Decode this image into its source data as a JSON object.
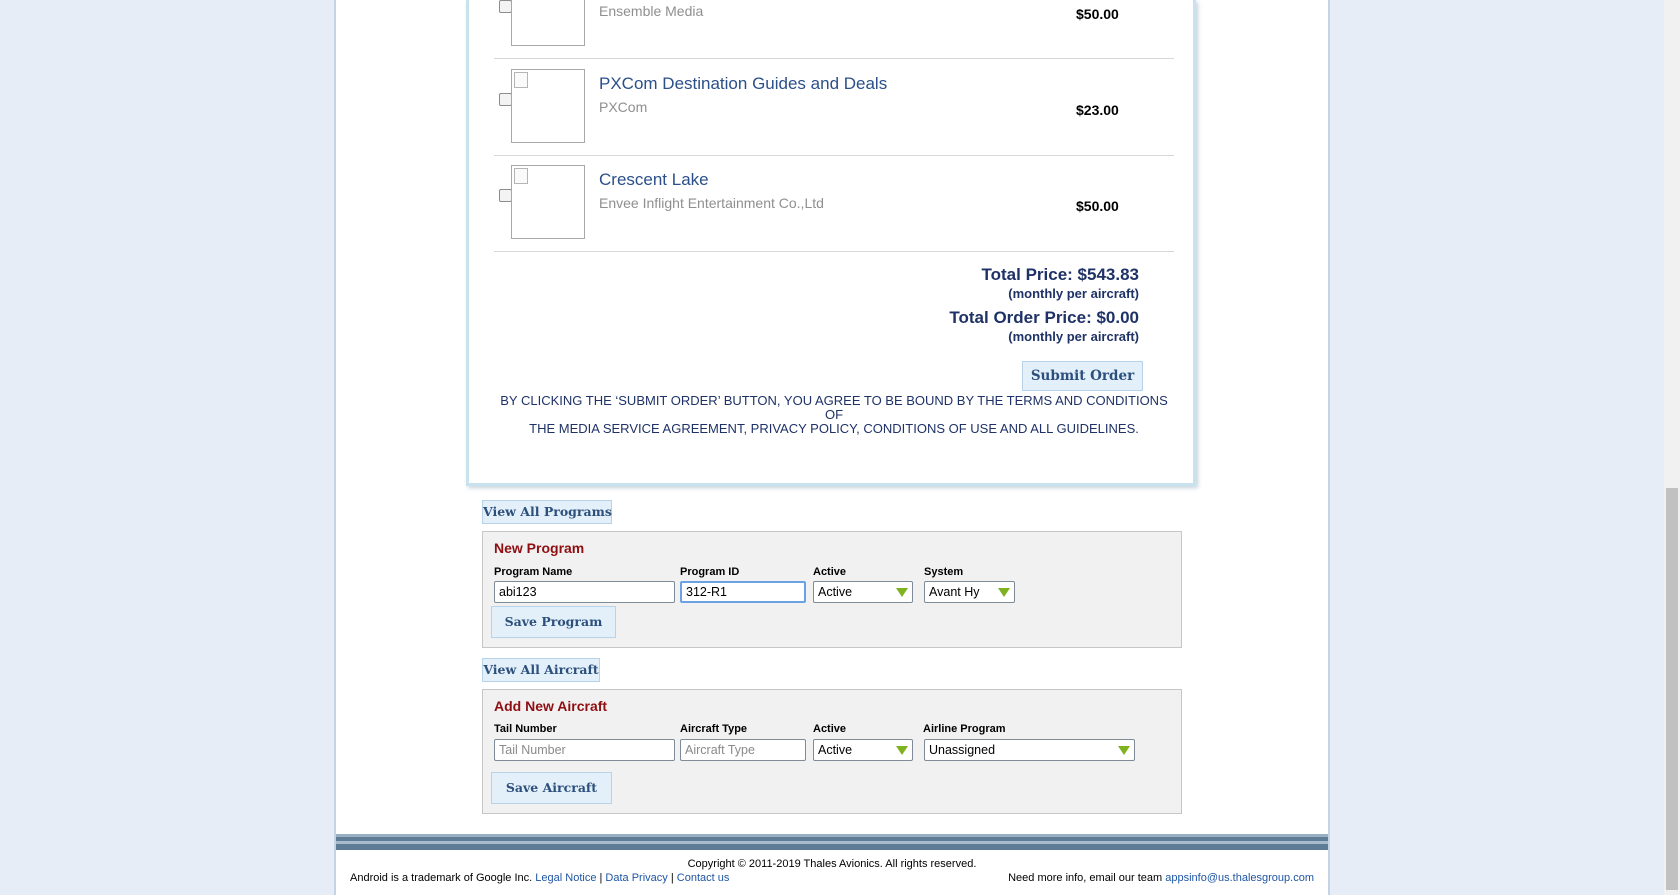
{
  "cart": {
    "items": [
      {
        "title": "",
        "vendor": "Ensemble Media",
        "price": "$50.00"
      },
      {
        "title": "PXCom Destination Guides and Deals",
        "vendor": "PXCom",
        "price": "$23.00"
      },
      {
        "title": "Crescent Lake",
        "vendor": "Envee Inflight Entertainment Co.,Ltd",
        "price": "$50.00"
      }
    ],
    "total_price": "Total Price: $543.83",
    "total_price_note": "(monthly per aircraft)",
    "total_order_price": "Total Order Price: $0.00",
    "total_order_note": "(monthly per aircraft)",
    "submit_label": "Submit Order",
    "terms_line1": "BY CLICKING THE ‘SUBMIT ORDER’ BUTTON, YOU AGREE TO BE BOUND BY THE TERMS AND CONDITIONS OF",
    "terms_line2": "THE MEDIA SERVICE AGREEMENT, PRIVACY POLICY, CONDITIONS OF USE AND ALL GUIDELINES."
  },
  "programs": {
    "view_all_label": "View All Programs",
    "panel_title": "New Program",
    "name_label": "Program Name",
    "name_value": "abi123",
    "id_label": "Program ID",
    "id_value": "312-R1",
    "active_label": "Active",
    "active_value": "Active",
    "system_label": "System",
    "system_value": "Avant Hy",
    "save_label": "Save Program"
  },
  "aircraft": {
    "view_all_label": "View All Aircraft",
    "panel_title": "Add New Aircraft",
    "tail_label": "Tail Number",
    "tail_placeholder": "Tail Number",
    "type_label": "Aircraft Type",
    "type_placeholder": "Aircraft Type",
    "active_label": "Active",
    "active_value": "Active",
    "program_label": "Airline Program",
    "program_value": "Unassigned",
    "save_label": "Save Aircraft"
  },
  "footer": {
    "copyright": "Copyright © 2011-2019 Thales Avionics. All rights reserved.",
    "android_text": "Android is a trademark of Google Inc.",
    "legal": "Legal Notice",
    "privacy": "Data Privacy",
    "contact": "Contact us",
    "sep": "|",
    "more_info": "Need more info, email our team",
    "email": "appsinfo@us.thalesgroup.com"
  },
  "colors": {
    "link": "#2b4f8a",
    "panel_title": "#8e0f12",
    "select_arrow": "#7fb21f",
    "total_text": "#1f3267"
  },
  "icons": [
    "checkbox",
    "broken-image-icon",
    "dropdown-arrow-icon"
  ]
}
